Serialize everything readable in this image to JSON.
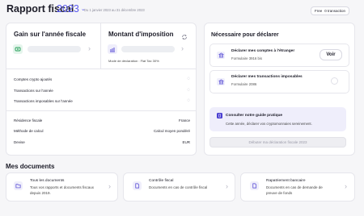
{
  "header": {
    "title": "Rapport fiscal",
    "year": "2023",
    "period": "Du 1 janvier 2023 au 31 décembre 2023",
    "plan": "Free",
    "tx_count": "0 transaction"
  },
  "gain": {
    "title": "Gain sur l'année fiscale"
  },
  "tax": {
    "title": "Montant d'imposition",
    "mode_label": "Mode de déclaration : Flat Tax 30%"
  },
  "rows": [
    {
      "label": "Comptes crypto ajoutés"
    },
    {
      "label": "Transactions sur l'année"
    },
    {
      "label": "Transactions imposables sur l'année"
    }
  ],
  "info": [
    {
      "label": "Résidence fiscale",
      "value": "France"
    },
    {
      "label": "Méthode de calcul",
      "value": "Calcul moyen pondéré"
    },
    {
      "label": "Devise",
      "value": "EUR"
    }
  ],
  "needed": {
    "title": "Nécessaire pour déclarer",
    "items": [
      {
        "title": "Déclarer mes comptes à l'étranger",
        "sub": "Formulaire 3916 bis",
        "button": "Voir"
      },
      {
        "title": "Déclarer mes transactions imposables",
        "sub": "Formulaire 2086"
      }
    ],
    "guide_title": "Consulter notre guide pratique",
    "guide_text": "Cette année, déclarer vos cryptomonnaies sereinement.",
    "cta": "Débuter ma déclaration fiscale 2023"
  },
  "docs": {
    "title": "Mes documents",
    "items": [
      {
        "title": "Tous les documents",
        "sub": "Tous vos rapports et documents fiscaux depuis 2019."
      },
      {
        "title": "Contrôle fiscal",
        "sub": "Documents en cas de contrôle fiscal"
      },
      {
        "title": "Rapatriement bancaire",
        "sub": "Documents en cas de demande de preuve de fonds"
      }
    ]
  },
  "colors": {
    "accent": "#4b3fd1",
    "green": "#1f9d55",
    "guide_bg": "#efeefb"
  }
}
